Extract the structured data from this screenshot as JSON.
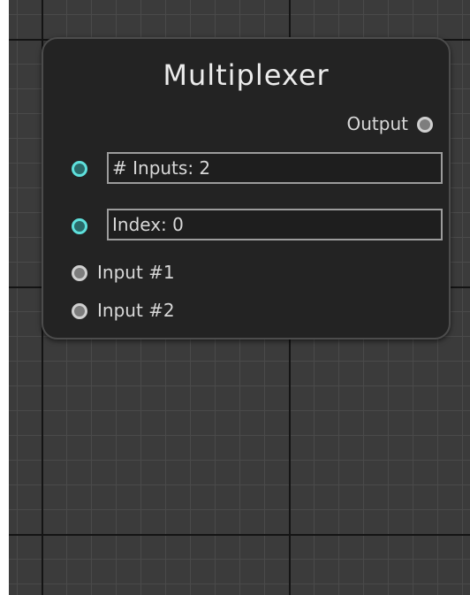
{
  "node": {
    "title": "Multiplexer",
    "output_label": "Output",
    "fields": [
      {
        "value": "# Inputs: 2"
      },
      {
        "value": "Index: 0"
      }
    ],
    "inputs": [
      {
        "label": "Input #1"
      },
      {
        "label": "Input #2"
      }
    ]
  },
  "colors": {
    "active_port": "#5ee0dc",
    "inactive_port": "#cfcfcf",
    "node_background": "#232323",
    "grid_background": "#3b3b3b"
  }
}
